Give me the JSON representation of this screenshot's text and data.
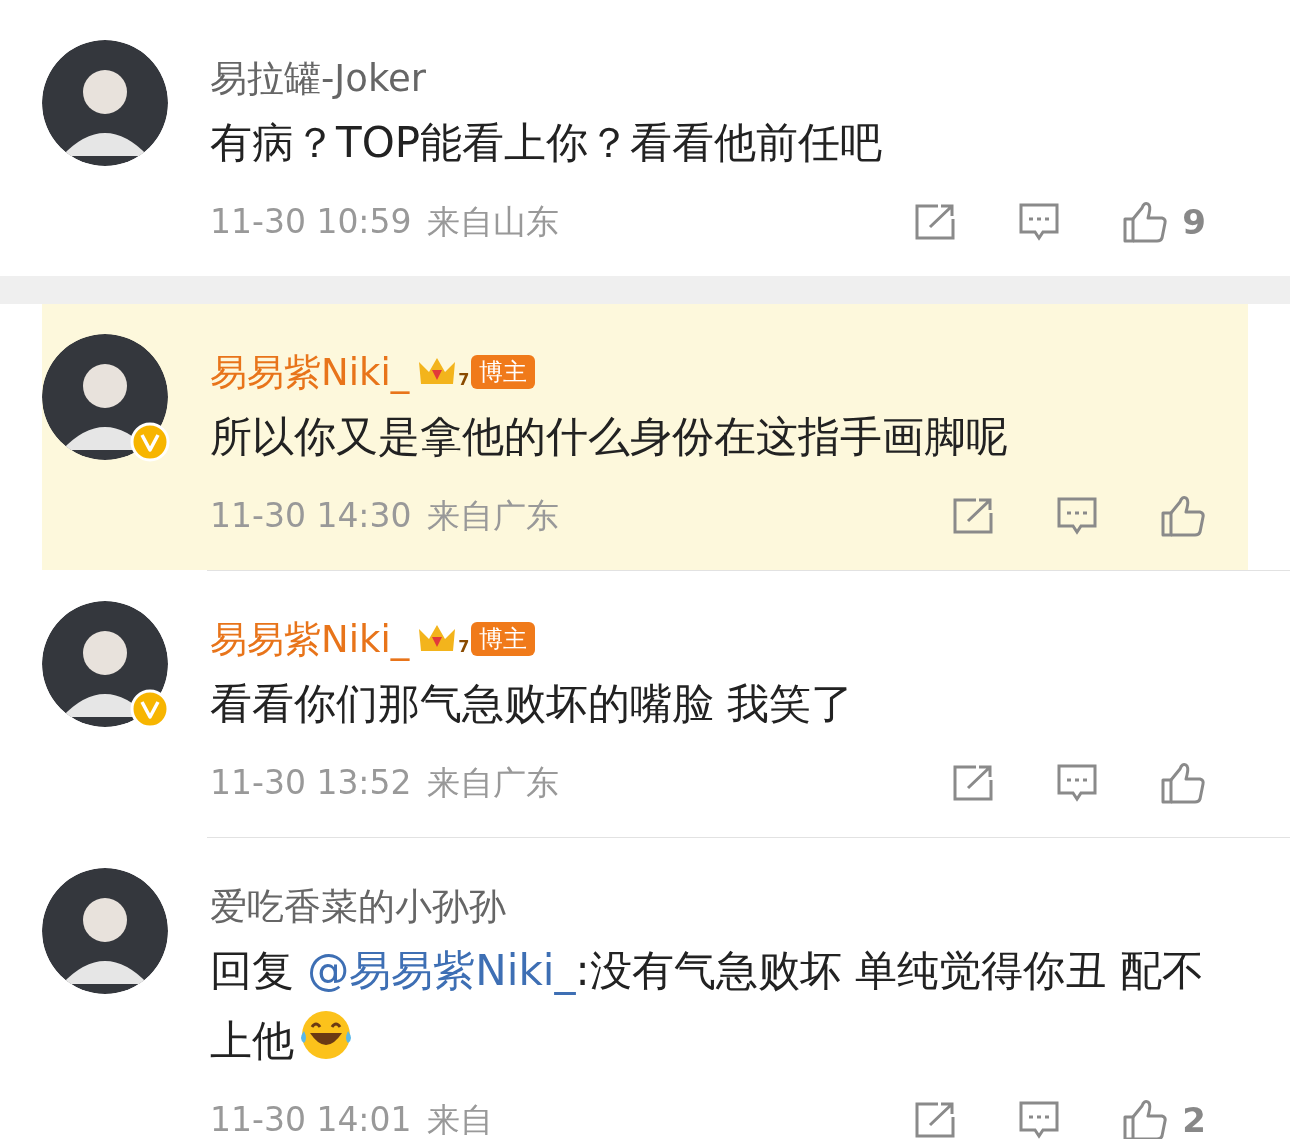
{
  "comments": [
    {
      "name": "易拉罐-Joker",
      "blogger": false,
      "verified": false,
      "highlighted": false,
      "content": [
        {
          "kind": "text",
          "text": "有病？TOP能看上你？看看他前任吧"
        }
      ],
      "time": "11-30 10:59",
      "location": "来自山东",
      "likes": "9"
    },
    {
      "name": "易易紫Niki_",
      "blogger": true,
      "badge": {
        "level": "7",
        "label": "博主"
      },
      "verified": true,
      "highlighted": true,
      "content": [
        {
          "kind": "text",
          "text": "所以你又是拿他的什么身份在这指手画脚呢"
        }
      ],
      "time": "11-30 14:30",
      "location": "来自广东"
    },
    {
      "name": "易易紫Niki_",
      "blogger": true,
      "badge": {
        "level": "7",
        "label": "博主"
      },
      "verified": true,
      "highlighted": false,
      "content": [
        {
          "kind": "text",
          "text": "看看你们那气急败坏的嘴脸 我笑了"
        }
      ],
      "time": "11-30 13:52",
      "location": "来自广东"
    },
    {
      "name": "爱吃香菜的小孙孙",
      "blogger": false,
      "verified": false,
      "highlighted": false,
      "content": [
        {
          "kind": "text",
          "text": "回复 "
        },
        {
          "kind": "mention",
          "text": "@易易紫Niki_"
        },
        {
          "kind": "text",
          "text": ":没有气急败坏 单纯觉得你丑 配不上他"
        },
        {
          "kind": "emoji"
        }
      ],
      "time": "11-30 14:01",
      "location": "来自",
      "likes": "2"
    }
  ]
}
